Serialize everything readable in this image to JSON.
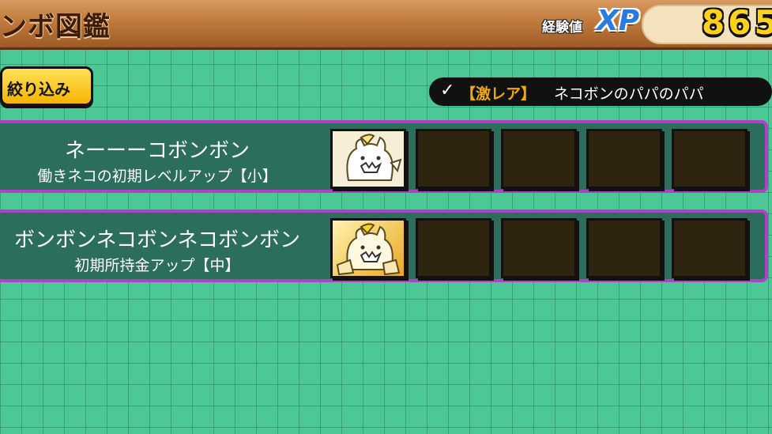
{
  "header": {
    "title": "ンボ図鑑",
    "xp_label": "経験値",
    "xp_badge": "XP",
    "xp_value": "865"
  },
  "filter": {
    "button_label": "絞り込み",
    "active_check": "✓",
    "active_rarity": "【激レア】",
    "active_name": "ネコボンのパパのパパ"
  },
  "combos": [
    {
      "name": "ネーーーコボンボン",
      "effect": "働きネコの初期レベルアップ【小】",
      "slot_style": "filled"
    },
    {
      "name": "ボンボンネコボンネコボンボン",
      "effect": "初期所持金アップ【中】",
      "slot_style": "gold"
    }
  ],
  "colors": {
    "background": "#4cc896",
    "row_border": "#b040c8",
    "xp_value": "#ffd21a",
    "rarity": "#f2a900"
  }
}
